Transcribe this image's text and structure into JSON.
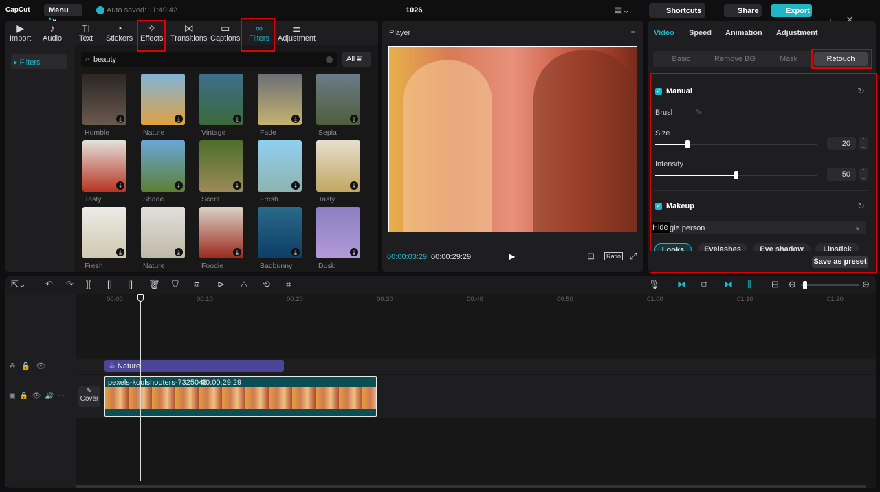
{
  "app": {
    "logo": "CapCut",
    "menu": "Menu",
    "autosave": "Auto saved: 11:49:42",
    "project_title": "1026",
    "shortcuts": "Shortcuts",
    "share": "Share",
    "export": "Export"
  },
  "tabs": [
    {
      "label": "Import",
      "icon": "import-icon"
    },
    {
      "label": "Audio",
      "icon": "audio-icon"
    },
    {
      "label": "Text",
      "icon": "text-icon"
    },
    {
      "label": "Stickers",
      "icon": "stickers-icon"
    },
    {
      "label": "Effects",
      "icon": "effects-icon"
    },
    {
      "label": "Transitions",
      "icon": "transitions-icon"
    },
    {
      "label": "Captions",
      "icon": "captions-icon"
    },
    {
      "label": "Filters",
      "icon": "filters-icon",
      "active": true
    },
    {
      "label": "Adjustment",
      "icon": "adjustment-icon"
    }
  ],
  "sidebar": {
    "items": [
      {
        "label": "Filters",
        "active": true
      }
    ]
  },
  "search": {
    "value": "beauty",
    "filter_label": "All"
  },
  "filters": [
    {
      "name": "Humble",
      "c1": "#2a2623",
      "c2": "#6a5a4e"
    },
    {
      "name": "Nature",
      "c1": "#7fb3d8",
      "c2": "#e0a040"
    },
    {
      "name": "Vintage",
      "c1": "#3c6e8c",
      "c2": "#3b6a3a"
    },
    {
      "name": "Fade",
      "c1": "#6a6f74",
      "c2": "#c7b270"
    },
    {
      "name": "Sepia",
      "c1": "#6a7c88",
      "c2": "#4f5e3a"
    },
    {
      "name": "Tasty",
      "c1": "#e3e1dc",
      "c2": "#b73523"
    },
    {
      "name": "Shade",
      "c1": "#6aa7d8",
      "c2": "#5d7f34"
    },
    {
      "name": "Scent",
      "c1": "#4d6e2c",
      "c2": "#9c8a5a"
    },
    {
      "name": "Fresh",
      "c1": "#8fd0f0",
      "c2": "#8fb3b0"
    },
    {
      "name": "Tasty",
      "c1": "#e6ded0",
      "c2": "#c2a760"
    },
    {
      "name": "Fresh",
      "c1": "#ecebe6",
      "c2": "#d0c8b0"
    },
    {
      "name": "Nature",
      "c1": "#e0e0dc",
      "c2": "#bfb8a5"
    },
    {
      "name": "Foodie",
      "c1": "#d9d3c7",
      "c2": "#9b2a1c"
    },
    {
      "name": "Badbunny",
      "c1": "#2a6a8a",
      "c2": "#0f3d66"
    },
    {
      "name": "Dusk",
      "c1": "#8a7fc0",
      "c2": "#b39ad8"
    }
  ],
  "player": {
    "title": "Player",
    "current_time": "00:00:03:29",
    "total_time": "00:00:29:29",
    "ratio": "Ratio"
  },
  "right_panel": {
    "tabs": [
      {
        "label": "Video",
        "active": true
      },
      {
        "label": "Speed"
      },
      {
        "label": "Animation"
      },
      {
        "label": "Adjustment"
      }
    ],
    "subtabs": [
      {
        "label": "Basic"
      },
      {
        "label": "Remove BG"
      },
      {
        "label": "Mask"
      },
      {
        "label": "Retouch",
        "active": true
      }
    ],
    "manual": {
      "title": "Manual",
      "brush": "Brush",
      "size_label": "Size",
      "size": 20,
      "intensity_label": "Intensity",
      "intensity": 50
    },
    "makeup": {
      "title": "Makeup",
      "select_value": "gle person",
      "tooltip": "Hide",
      "pills": [
        "Looks",
        "Eyelashes",
        "Eye shadow",
        "Lipstick"
      ]
    },
    "save_preset": "Save as preset"
  },
  "timeline": {
    "ruler": [
      "00:00",
      "00:10",
      "00:20",
      "00:30",
      "00:40",
      "00:50",
      "01:00",
      "01:10",
      "01:20"
    ],
    "filter_clip": "Nature",
    "video_clip_name": "pexels-koolshooters-7325048",
    "video_clip_duration": "00:00:29:29",
    "cover": "Cover"
  },
  "colors": {
    "accent": "#1fb6c7",
    "highlight": "#e00000",
    "filter_clip": "#4c4496",
    "video_clip": "#0b4f55"
  }
}
